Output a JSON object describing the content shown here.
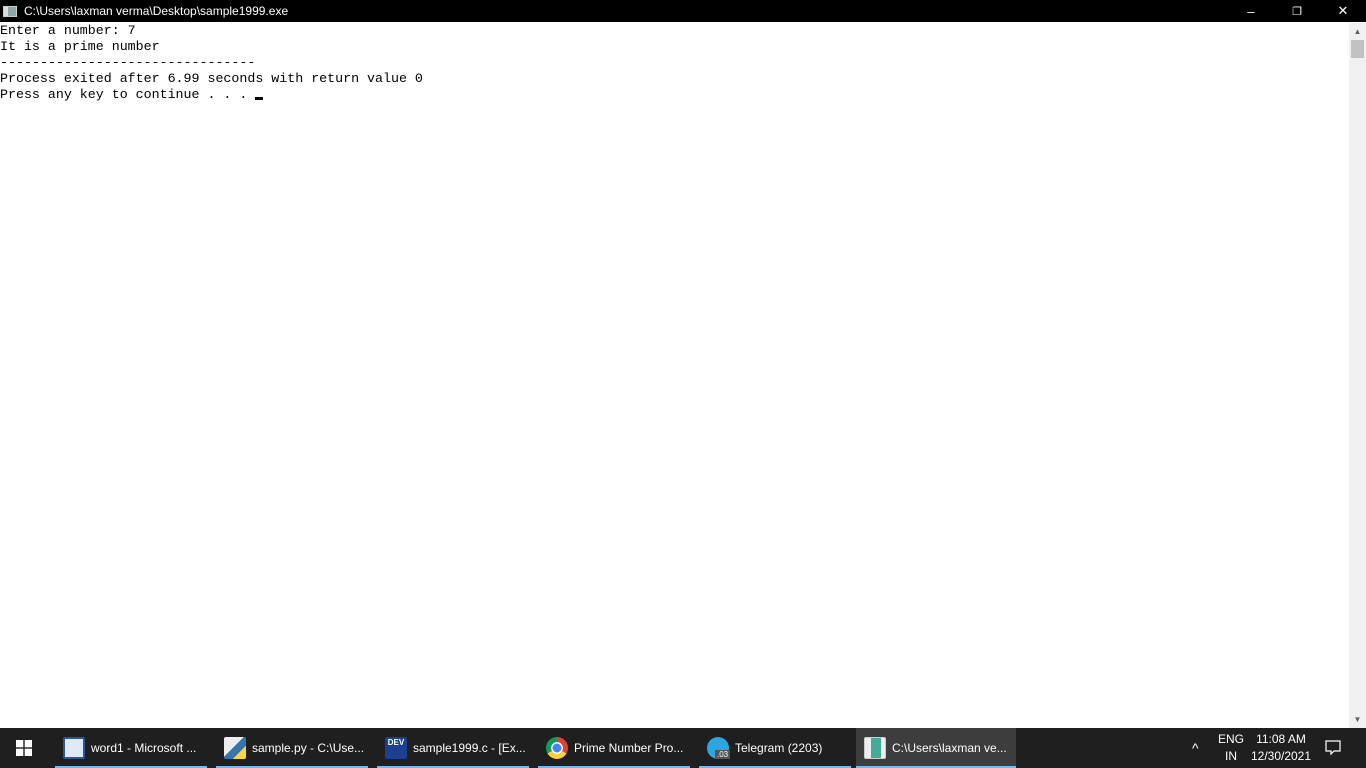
{
  "window": {
    "title": "C:\\Users\\laxman verma\\Desktop\\sample1999.exe",
    "minimize": "–",
    "restore": "❐",
    "close": "✕"
  },
  "console": {
    "lines": [
      "Enter a number: 7",
      "It is a prime number",
      "--------------------------------",
      "Process exited after 6.99 seconds with return value 0",
      "Press any key to continue . . . "
    ]
  },
  "taskbar": {
    "items": [
      {
        "label": "word1 - Microsoft ...",
        "icon": "word-icon",
        "color": "#2b579a"
      },
      {
        "label": "sample.py - C:\\Use...",
        "icon": "python-icon",
        "color": "#3776ab"
      },
      {
        "label": "sample1999.c - [Ex...",
        "icon": "devcpp-icon",
        "color": "#1c3f8f"
      },
      {
        "label": "Prime Number Pro...",
        "icon": "chrome-icon",
        "color": "#db4437"
      },
      {
        "label": "Telegram (2203)",
        "icon": "telegram-icon",
        "color": "#2ca5e0"
      },
      {
        "label": "C:\\Users\\laxman ve...",
        "icon": "console-icon",
        "color": "#6a9"
      }
    ],
    "tray": {
      "lang_top": "ENG",
      "lang_bottom": "IN",
      "time": "11:08 AM",
      "date": "12/30/2021",
      "chevron": "^",
      "telegram_badge": ".03"
    }
  }
}
